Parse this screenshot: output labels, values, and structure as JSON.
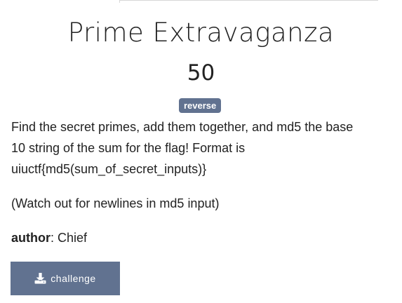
{
  "challenge": {
    "title": "Prime Extravaganza",
    "points": "50",
    "category_tag": "reverse",
    "description_lines": [
      "Find the secret primes, add them together, and md5 the base",
      "10 string of the sum for the flag! Format is",
      "uiuctf{md5(sum_of_secret_inputs)}"
    ],
    "note": "(Watch out for newlines in md5 input)",
    "author_label": "author",
    "author_separator": ": ",
    "author_name": "Chief",
    "download_label": "challenge",
    "download_icon": "download-icon"
  },
  "colors": {
    "accent": "#617290",
    "text": "#222222",
    "background": "#ffffff"
  }
}
